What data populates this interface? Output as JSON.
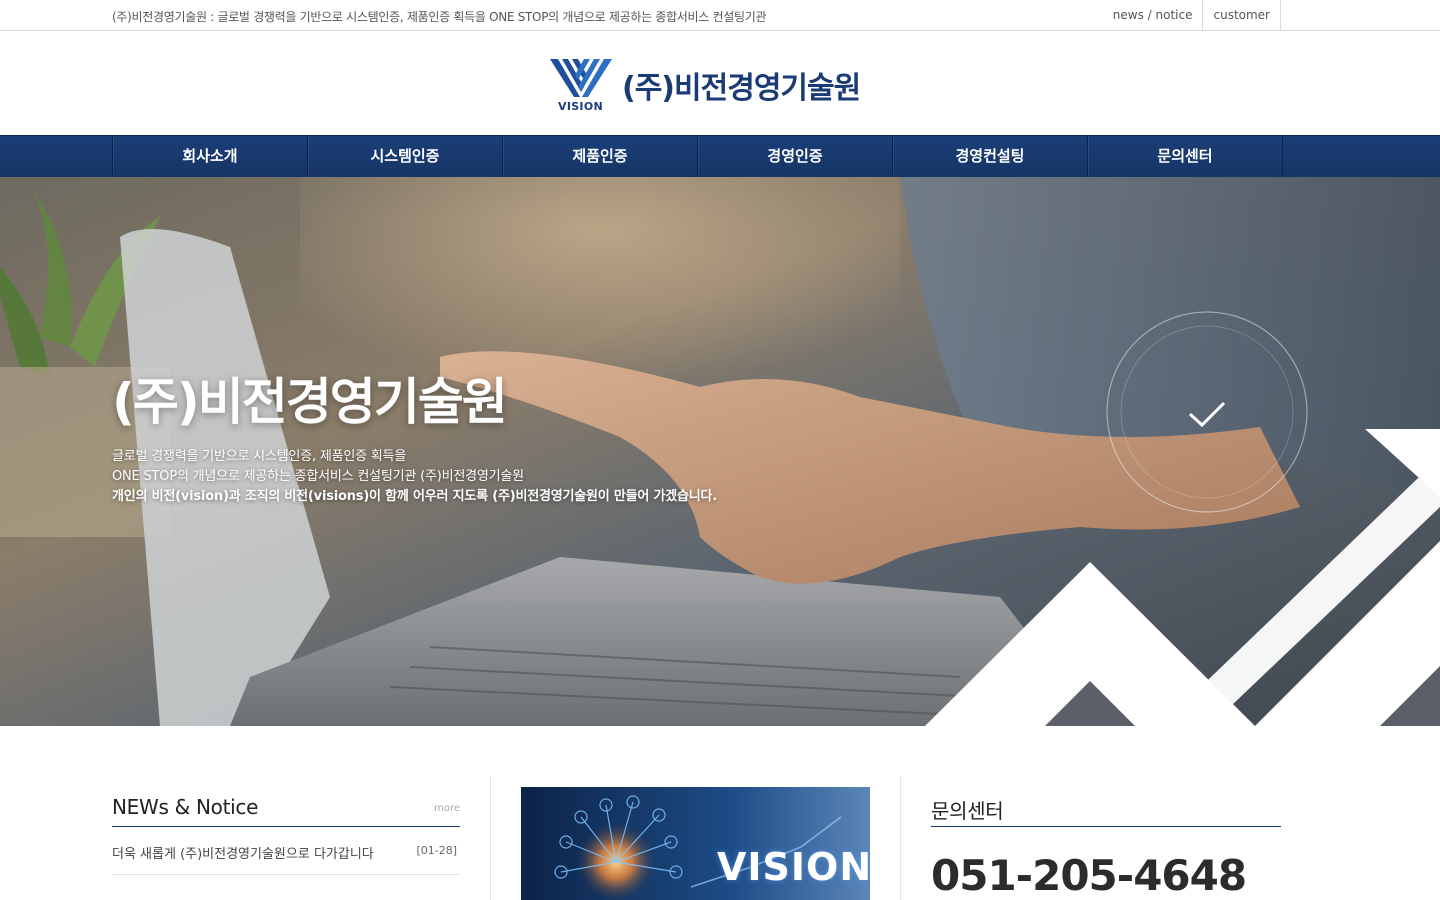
{
  "topbar": {
    "tagline": "(주)비전경영기술원 : 글로벌 경쟁력을 기반으로 시스템인증, 제품인증 획득을 ONE STOP의 개념으로 제공하는 종합서비스 컨설팅기관",
    "news_link": "news / notice",
    "customer_link": "customer"
  },
  "logo": {
    "mark_text": "VISION",
    "company_name": "(주)비전경영기술원",
    "icon": "vision-logo-icon"
  },
  "nav": {
    "items": [
      {
        "label": "회사소개"
      },
      {
        "label": "시스템인증"
      },
      {
        "label": "제품인증"
      },
      {
        "label": "경영인증"
      },
      {
        "label": "경영컨설팅"
      },
      {
        "label": "문의센터"
      }
    ]
  },
  "hero": {
    "title": "(주)비전경영기술원",
    "line1": "글로벌 경쟁력을 기반으로 시스템인증, 제품인증 획득을",
    "line2": "ONE STOP의 개념으로 제공하는 종합서비스 컨설팅기관 (주)비전경영기술원",
    "line3": "개인의 비전(vision)과 조직의 비전(visions)이 함께 어우러 지도록 (주)비전경영기술원이 만들어 가겠습니다.",
    "check_icon": "checkmark-icon"
  },
  "news": {
    "title": "NEWs & Notice",
    "more": "more",
    "items": [
      {
        "title": "더욱 새롭게 (주)비전경영기술원으로 다가갑니다",
        "date": "[01-28]"
      }
    ]
  },
  "banner": {
    "word": "VISION"
  },
  "contact": {
    "title": "문의센터",
    "phone": "051-205-4648"
  },
  "colors": {
    "brand_navy": "#1b3b74",
    "nav_bg": "#173566",
    "white": "#ffffff"
  }
}
